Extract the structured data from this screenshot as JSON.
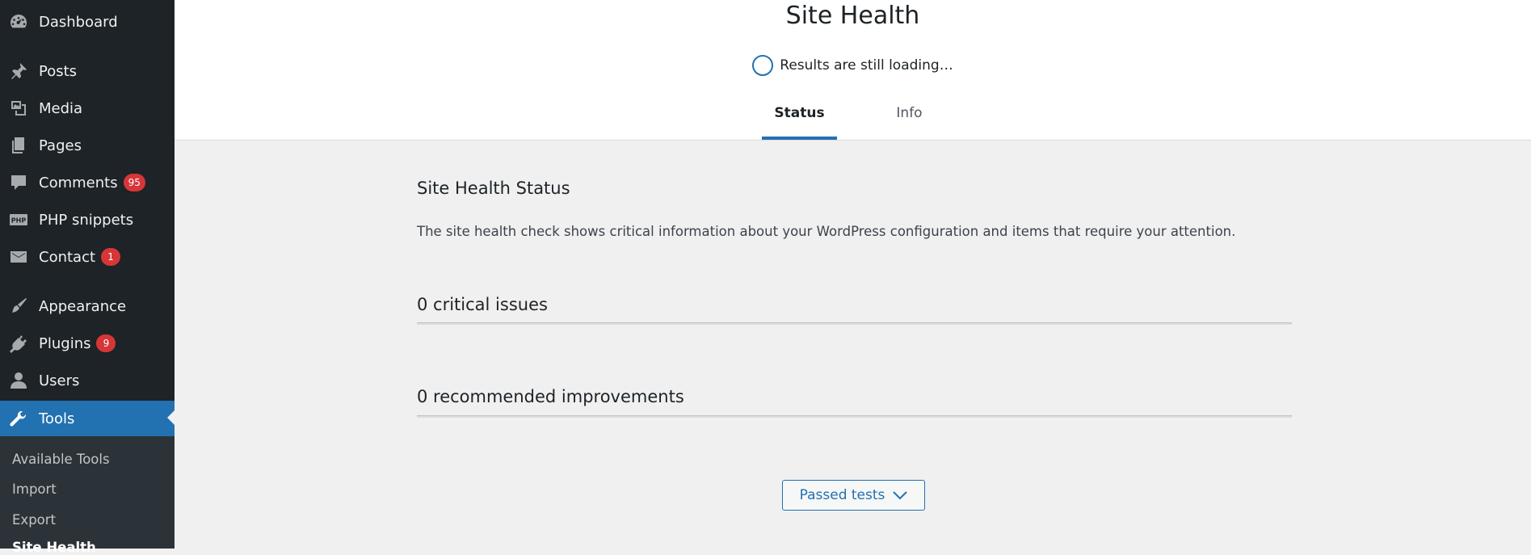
{
  "sidebar": {
    "items": [
      {
        "label": "Dashboard",
        "icon": "dashboard-icon",
        "badge": null
      },
      {
        "label": "Posts",
        "icon": "pin-icon",
        "badge": null
      },
      {
        "label": "Media",
        "icon": "media-icon",
        "badge": null
      },
      {
        "label": "Pages",
        "icon": "pages-icon",
        "badge": null
      },
      {
        "label": "Comments",
        "icon": "comment-icon",
        "badge": "95"
      },
      {
        "label": "PHP snippets",
        "icon": "php-icon",
        "badge": null
      },
      {
        "label": "Contact",
        "icon": "mail-icon",
        "badge": "1"
      },
      {
        "label": "Appearance",
        "icon": "brush-icon",
        "badge": null
      },
      {
        "label": "Plugins",
        "icon": "plug-icon",
        "badge": "9"
      },
      {
        "label": "Users",
        "icon": "user-icon",
        "badge": null
      },
      {
        "label": "Tools",
        "icon": "wrench-icon",
        "badge": null
      }
    ],
    "submenu": [
      {
        "label": "Available Tools"
      },
      {
        "label": "Import"
      },
      {
        "label": "Export"
      },
      {
        "label": "Site Health"
      }
    ]
  },
  "header": {
    "title": "Site Health",
    "loading_text": "Results are still loading…",
    "tabs": [
      {
        "label": "Status"
      },
      {
        "label": "Info"
      }
    ]
  },
  "main": {
    "section_title": "Site Health Status",
    "description": "The site health check shows critical information about your WordPress configuration and items that require your attention.",
    "critical_issues": "0 critical issues",
    "recommended": "0 recommended improvements",
    "passed_button": "Passed tests"
  },
  "colors": {
    "accent": "#2271b1",
    "sidebar_bg": "#1d2327",
    "badge": "#d63638"
  }
}
